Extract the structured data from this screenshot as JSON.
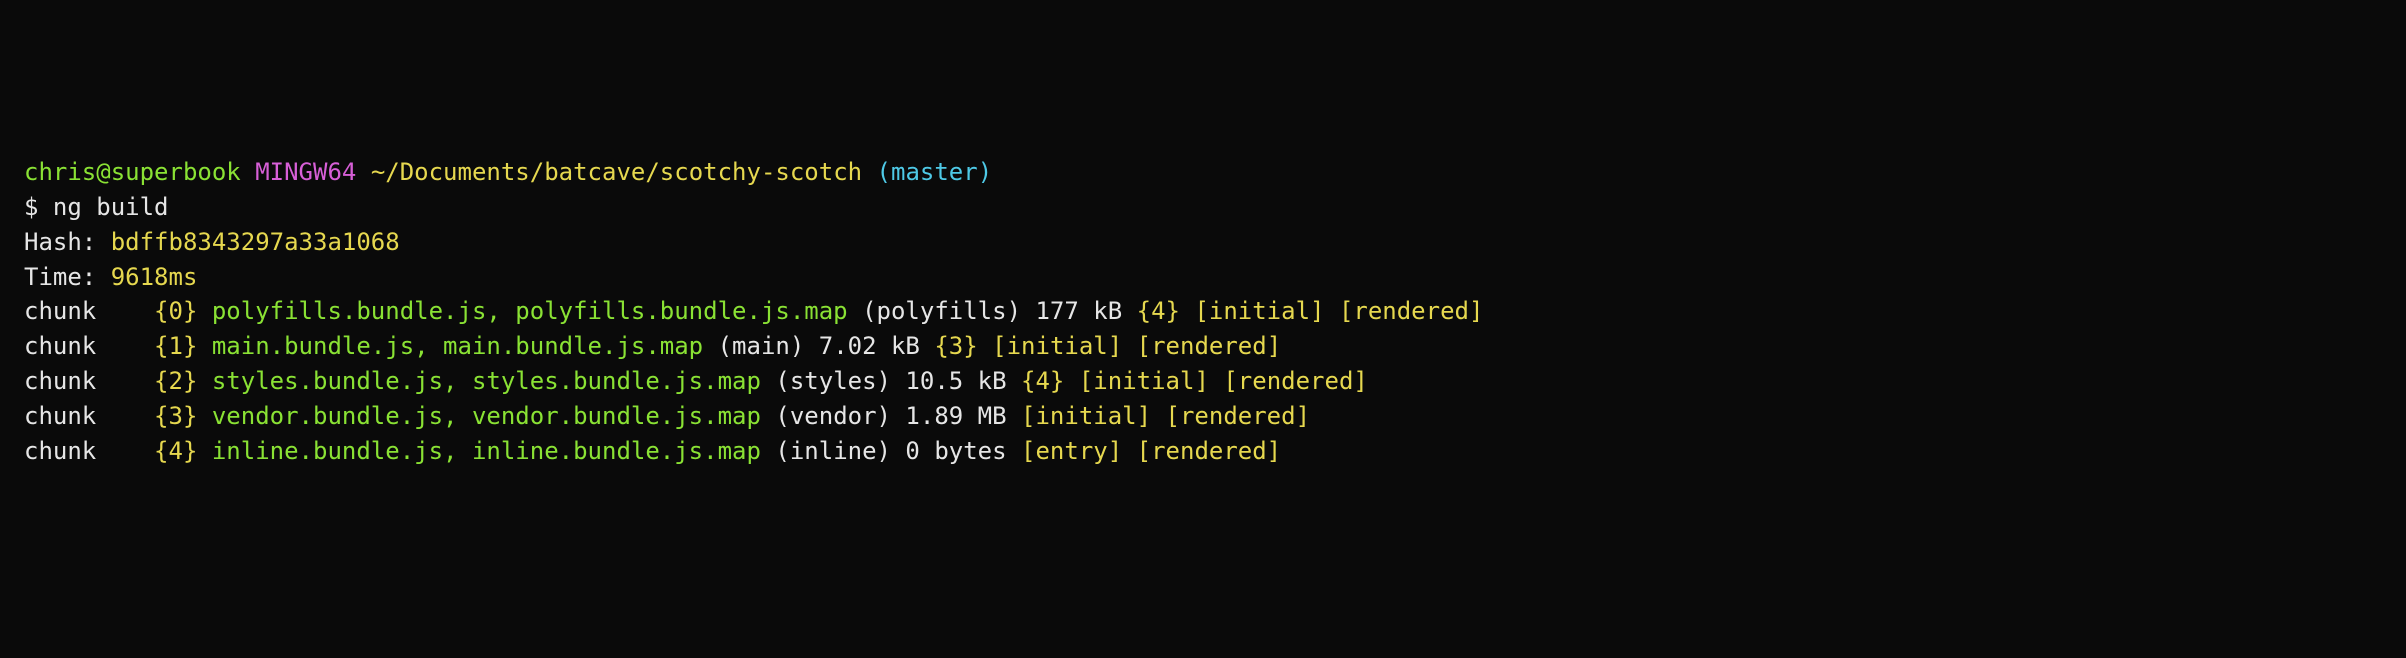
{
  "prompt": {
    "user": "chris",
    "host": "superbook",
    "env": "MINGW64",
    "path": "~/Documents/batcave/scotchy-scotch",
    "branch": "(master)"
  },
  "command": {
    "symbol": "$",
    "text": "ng build"
  },
  "hash": {
    "label": "Hash:",
    "value": "bdffb8343297a33a1068"
  },
  "time": {
    "label": "Time:",
    "value": "9618ms"
  },
  "chunks": [
    {
      "idx": "{0}",
      "files": "polyfills.bundle.js, polyfills.bundle.js.map",
      "meta": "(polyfills) 177 kB",
      "deps": "{4}",
      "tags": [
        "[initial]",
        "[rendered]"
      ]
    },
    {
      "idx": "{1}",
      "files": "main.bundle.js, main.bundle.js.map",
      "meta": "(main) 7.02 kB",
      "deps": "{3}",
      "tags": [
        "[initial]",
        "[rendered]"
      ]
    },
    {
      "idx": "{2}",
      "files": "styles.bundle.js, styles.bundle.js.map",
      "meta": "(styles) 10.5 kB",
      "deps": "{4}",
      "tags": [
        "[initial]",
        "[rendered]"
      ]
    },
    {
      "idx": "{3}",
      "files": "vendor.bundle.js, vendor.bundle.js.map",
      "meta": "(vendor) 1.89 MB",
      "deps": "",
      "tags": [
        "[initial]",
        "[rendered]"
      ]
    },
    {
      "idx": "{4}",
      "files": "inline.bundle.js, inline.bundle.js.map",
      "meta": "(inline) 0 bytes",
      "deps": "",
      "tags": [
        "[entry]",
        "[rendered]"
      ]
    }
  ],
  "lbl": {
    "chunk": "chunk",
    "at": "@"
  }
}
